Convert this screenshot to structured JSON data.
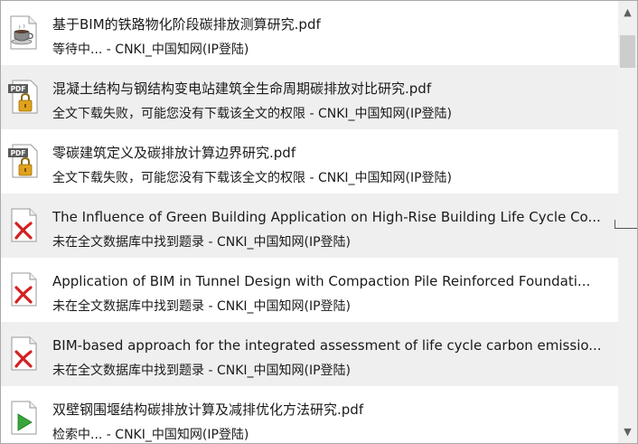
{
  "items": [
    {
      "icon": "coffee-cup-icon",
      "title": "基于BIM的铁路物化阶段碳排放测算研究.pdf",
      "status": "等待中...  -  CNKI_中国知网(IP登陆)"
    },
    {
      "icon": "pdf-locked-icon",
      "title": "混凝土结构与钢结构变电站建筑全生命周期碳排放对比研究.pdf",
      "status": "全文下载失败，可能您没有下载该全文的权限  -  CNKI_中国知网(IP登陆)"
    },
    {
      "icon": "pdf-locked-icon",
      "title": "零碳建筑定义及碳排放计算边界研究.pdf",
      "status": "全文下载失败，可能您没有下载该全文的权限  -  CNKI_中国知网(IP登陆)"
    },
    {
      "icon": "failed-red-x-icon",
      "title": "The Influence of Green Building Application on High-Rise Building Life Cycle Co...",
      "status": "未在全文数据库中找到题录  -  CNKI_中国知网(IP登陆)"
    },
    {
      "icon": "failed-red-x-icon",
      "title": "Application of BIM in Tunnel Design with Compaction Pile Reinforced Foundati...",
      "status": "未在全文数据库中找到题录  -  CNKI_中国知网(IP登陆)"
    },
    {
      "icon": "failed-red-x-icon",
      "title": "BIM-based approach for the integrated assessment of life cycle carbon emissio...",
      "status": "未在全文数据库中找到题录  -  CNKI_中国知网(IP登陆)"
    },
    {
      "icon": "play-green-icon",
      "title": "双壁钢围堰结构碳排放计算及减排优化方法研究.pdf",
      "status": "检索中...  -  CNKI_中国知网(IP登陆)"
    }
  ],
  "scrollbar": {
    "up_glyph": "▲",
    "down_glyph": "▼"
  },
  "colors": {
    "row_alt_bg": "#efefef",
    "fail_red": "#d42020",
    "play_green": "#3aa53a",
    "lock_gold": "#e0a21a"
  }
}
